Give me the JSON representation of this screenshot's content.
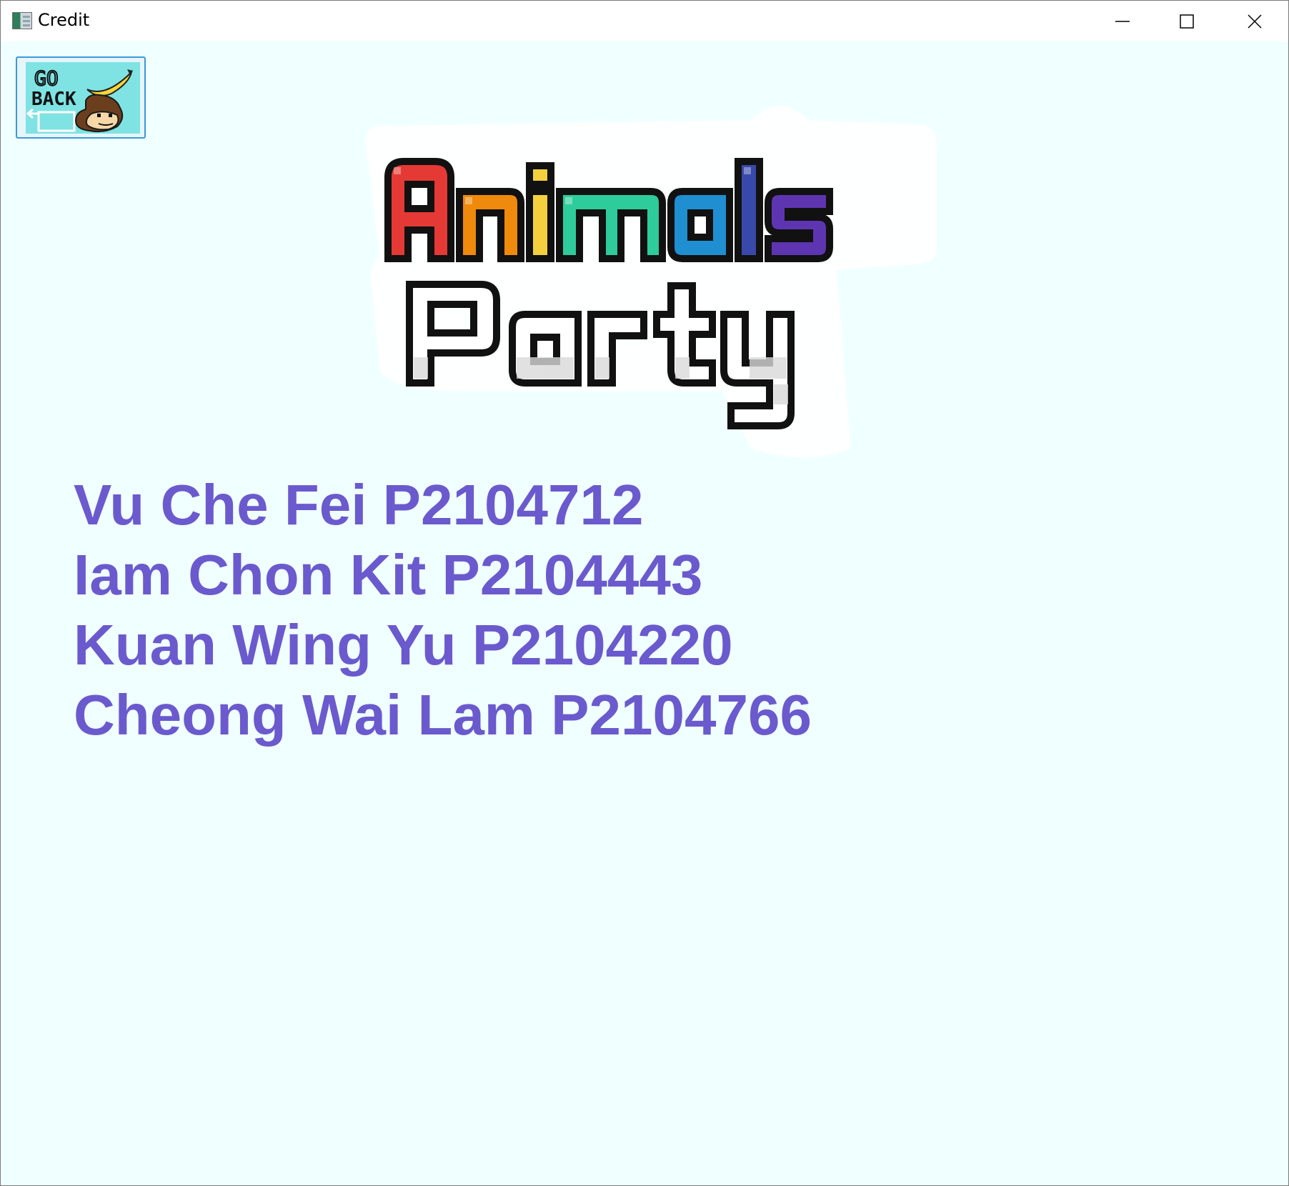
{
  "window": {
    "title": "Credit"
  },
  "back_button": {
    "text_line1": "GO",
    "text_line2": "BACK",
    "icon": "monkey-with-banana-icon"
  },
  "logo": {
    "word1_letters": [
      "A",
      "n",
      "i",
      "m",
      "a",
      "l",
      "s"
    ],
    "word1_colors": [
      "#e53935",
      "#ef8a0c",
      "#f4d03f",
      "#2ecc9a",
      "#1f8fd1",
      "#3949ab",
      "#5e35b1"
    ],
    "word2": "Party"
  },
  "credits": [
    "Vu Che Fei P2104712",
    "Iam Chon Kit P2104443",
    "Kuan Wing Yu P2104220",
    "Cheong Wai Lam P2104766"
  ],
  "colors": {
    "background": "#f0ffff",
    "credit_text": "#6a5acd",
    "button_border": "#3a9ad9"
  }
}
